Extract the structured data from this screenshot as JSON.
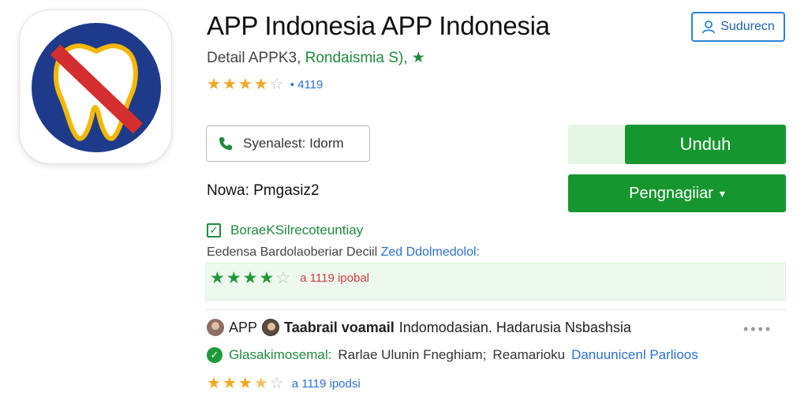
{
  "header": {
    "title": "APP Indonesia APP Indonesia",
    "subtitle_prefix": "Detail APPK3,",
    "developer": "Rondaismia S),",
    "subscribe_label": "Sudurecn"
  },
  "rating": {
    "stars": 4,
    "max": 5,
    "count": "4119"
  },
  "actions": {
    "contact_label": "Syenalest: Idorm",
    "download_label": "Unduh",
    "settings_label": "Pengnagiiar"
  },
  "version": "Nowa: Pmgasiz2",
  "verified": "BoraeKSilrecoteuntiay",
  "description": {
    "text": "Eedensa Bardolaoberiar Deciil",
    "link": "Zed Ddolmedolol:"
  },
  "highlight": {
    "stars": 4,
    "count": "a 1119 ipobal"
  },
  "review": {
    "label": "APP",
    "name": "Taabrail voamail",
    "text": "Indomodasian. Hadarusia Nsbashsia"
  },
  "guarantee": {
    "label": "Glasakimosemal:",
    "text": "Rarlae Ulunin Fneghiam;",
    "text2": "Reamarioku",
    "link": "Danuunicenl Parlioos"
  },
  "bottom_rating": {
    "stars": 3.5,
    "count": "a 1119 ipodsi"
  },
  "colors": {
    "primary_green": "#16962e",
    "link_blue": "#2a6fd6",
    "star_orange": "#f5a623",
    "icon_blue": "#1e3a8a",
    "icon_red": "#d32f2f",
    "icon_gold": "#f5b800"
  },
  "icons": {
    "app": "tooth-prohibited-icon",
    "subscribe": "person-icon",
    "contact": "phone-icon",
    "settings": "chevron-down-icon",
    "more": "more-dots-icon"
  }
}
